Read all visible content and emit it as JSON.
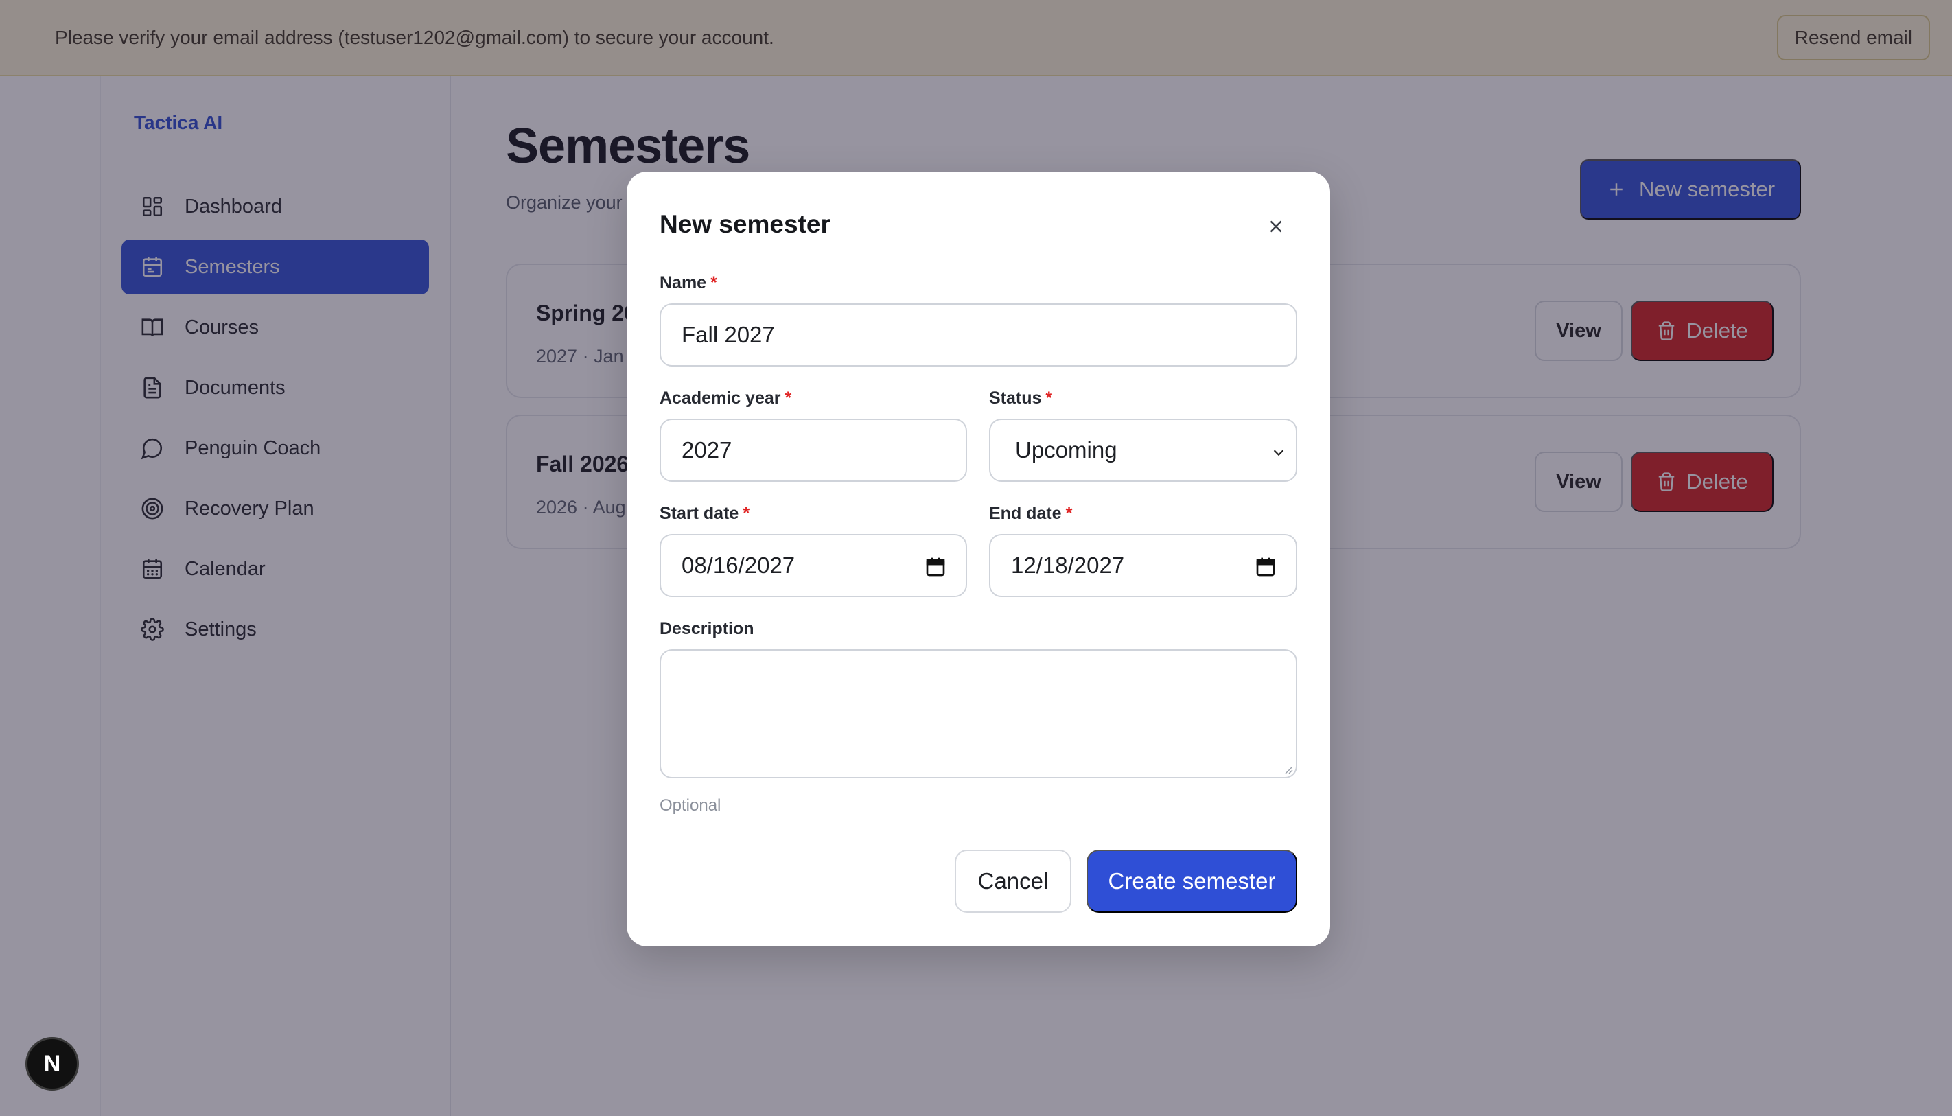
{
  "banner": {
    "message": "Please verify your email address (testuser1202@gmail.com) to secure your account.",
    "resend_label": "Resend email"
  },
  "sidebar": {
    "brand": "Tactica AI",
    "items": [
      {
        "label": "Dashboard",
        "icon": "dashboard-icon",
        "active": false
      },
      {
        "label": "Semesters",
        "icon": "calendar-icon",
        "active": true
      },
      {
        "label": "Courses",
        "icon": "book-icon",
        "active": false
      },
      {
        "label": "Documents",
        "icon": "document-icon",
        "active": false
      },
      {
        "label": "Penguin Coach",
        "icon": "chat-bubble-icon",
        "active": false
      },
      {
        "label": "Recovery Plan",
        "icon": "target-icon",
        "active": false
      },
      {
        "label": "Calendar",
        "icon": "calendar-grid-icon",
        "active": false
      },
      {
        "label": "Settings",
        "icon": "gear-icon",
        "active": false
      }
    ]
  },
  "main": {
    "title": "Semesters",
    "subtitle": "Organize your",
    "new_button_label": "New semester",
    "semesters": [
      {
        "name": "Spring 20",
        "meta": "2027 · Jan",
        "view_label": "View",
        "delete_label": "Delete"
      },
      {
        "name": "Fall 2026",
        "meta": "2026 · Aug",
        "view_label": "View",
        "delete_label": "Delete"
      }
    ]
  },
  "modal": {
    "title": "New semester",
    "fields": {
      "name": {
        "label": "Name",
        "required_mark": "*",
        "value": "Fall 2027"
      },
      "academic_year": {
        "label": "Academic year",
        "required_mark": "*",
        "value": "2027"
      },
      "status": {
        "label": "Status",
        "required_mark": "*",
        "value": "Upcoming"
      },
      "start_date": {
        "label": "Start date",
        "required_mark": "*",
        "value": "08/16/2027"
      },
      "end_date": {
        "label": "End date",
        "required_mark": "*",
        "value": "12/18/2027"
      },
      "description": {
        "label": "Description",
        "value": "",
        "hint": "Optional"
      }
    },
    "cancel_label": "Cancel",
    "submit_label": "Create semester"
  },
  "dev_badge": {
    "label": "N"
  },
  "colors": {
    "primary": "#2f4fd6",
    "danger": "#d12020",
    "banner_bg": "#fcf4d6",
    "required": "#e02424"
  }
}
